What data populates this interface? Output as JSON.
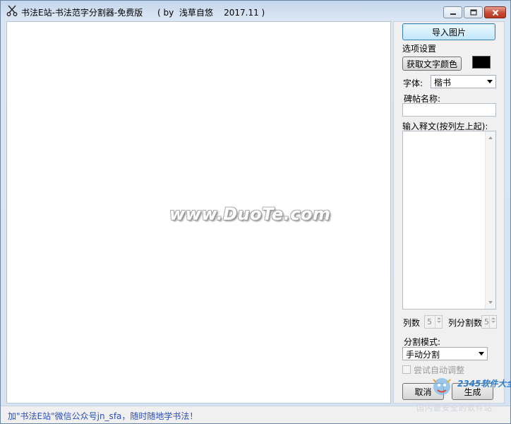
{
  "window": {
    "title": "书法E站-书法范字分割器-免费版",
    "title_extra": "( by  浅草自悠    2017.11 )"
  },
  "canvas": {
    "watermark": "www.DuoTe.com"
  },
  "panel": {
    "import_button": "导入图片",
    "options_section": "选项设置",
    "get_color_button": "获取文字颜色",
    "text_color": "#000000",
    "font_label": "字体:",
    "font_value": "楷书",
    "tablet_name_label": "碑帖名称:",
    "tablet_name_value": "",
    "transcript_label": "输入释文(按列左上起):",
    "transcript_value": "",
    "columns_label": "列数",
    "columns_value": "5",
    "rows_per_column_label": "列分割数",
    "rows_per_column_value": "5",
    "split_mode_label": "分割模式:",
    "split_mode_value": "手动分割",
    "auto_adjust_label": "尝试自动调整",
    "auto_adjust_checked": false,
    "cancel_button": "取消",
    "generate_button": "生成"
  },
  "status": {
    "text": "加\"书法E站\"微信公众号jn_sfa，随时随地学书法！"
  },
  "logo_watermark": {
    "text": "2345软件大全",
    "subtext": "国内最安全的软件站"
  }
}
